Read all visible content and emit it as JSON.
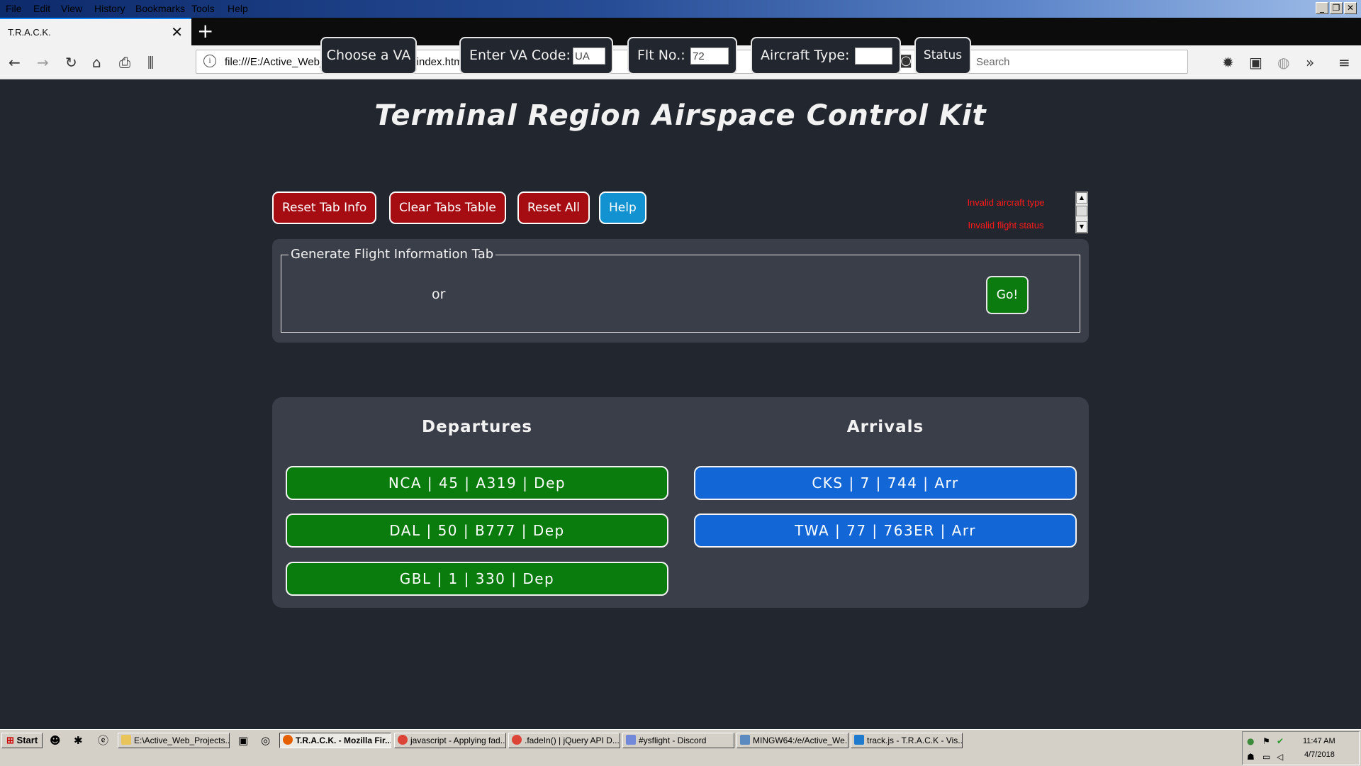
{
  "browser": {
    "menu": [
      "File",
      "Edit",
      "View",
      "History",
      "Bookmarks",
      "Tools",
      "Help"
    ],
    "window_buttons": {
      "minimize": "_",
      "restore": "❐",
      "close": "✕"
    },
    "tab_title": "T.R.A.C.K.",
    "tab_close": "✕",
    "new_tab": "+",
    "url": "file:///E:/Active_Web_Projects/T.R.A.C.K/index.html",
    "search_placeholder": "Search",
    "icons": {
      "back": "←",
      "forward": "→",
      "reload": "↻",
      "home": "⌂",
      "print": "⎙",
      "library": "⫼",
      "more": "•••",
      "pocket": "◙",
      "star": "☆",
      "info": "i",
      "search": "⚲",
      "settings": "✹",
      "sidebar": "▣",
      "addon": "◍",
      "overflow": "»",
      "hamburger": "≡"
    }
  },
  "page": {
    "title": "Terminal Region Airspace Control Kit",
    "buttons": {
      "reset_tab_info": "Reset Tab Info",
      "clear_tabs_table": "Clear Tabs Table",
      "reset_all": "Reset All",
      "help": "Help"
    },
    "errors": [
      "Invalid aircraft type",
      "Invalid flight status"
    ],
    "generate": {
      "legend": "Generate Flight Information Tab",
      "choose_va": "Choose a VA",
      "or": "or",
      "va_code_label": "Enter VA Code:",
      "va_code_value": "UA",
      "flt_no_label": "Flt No.:",
      "flt_no_value": "72",
      "aircraft_type_label": "Aircraft Type:",
      "aircraft_type_value": "",
      "status": "Status",
      "go": "Go!"
    },
    "departures": {
      "heading": "Departures",
      "items": [
        "NCA | 45 | A319 | Dep",
        "DAL | 50 | B777 | Dep",
        "GBL | 1 | 330 | Dep"
      ]
    },
    "arrivals": {
      "heading": "Arrivals",
      "items": [
        "CKS | 7 | 744 | Arr",
        "TWA | 77 | 763ER | Arr"
      ]
    },
    "colors": {
      "background": "#22262e",
      "panel": "#3a3e49",
      "reset_red": "#a50d12",
      "help_blue": "#1292d0",
      "dep_green": "#0a7c0d",
      "arr_blue": "#1266d6",
      "error_red": "#ff1a1a"
    }
  },
  "taskbar": {
    "start": "Start",
    "items": [
      "E:\\Active_Web_Projects...",
      "T.R.A.C.K. - Mozilla Fir...",
      "javascript - Applying fad...",
      ".fadeIn() | jQuery API D...",
      "#ysflight - Discord",
      "MINGW64:/e/Active_We...",
      "track.js - T.R.A.C.K - Vis..."
    ],
    "time": "11:47 AM",
    "date": "4/7/2018"
  }
}
